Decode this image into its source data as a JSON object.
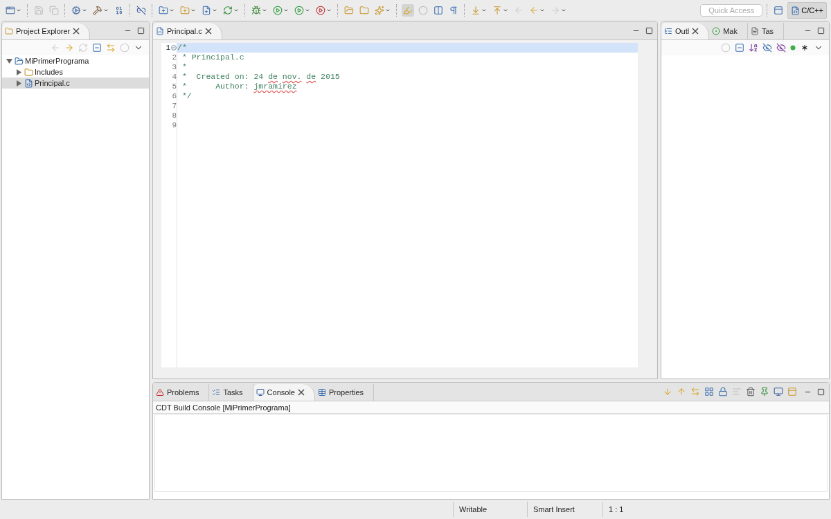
{
  "toolbar": {
    "quick_access": {
      "placeholder": "Quick Access"
    },
    "perspectives": [
      {
        "label": "C/C++",
        "selected": true
      }
    ]
  },
  "project_explorer": {
    "tabs": [
      {
        "label": "Project Explorer",
        "selected": true
      }
    ],
    "tree": [
      {
        "label": "MiPrimerPrograma",
        "expanded": true,
        "selected": false,
        "children": [
          {
            "label": "Includes",
            "expanded": false,
            "selected": false
          },
          {
            "label": "Principal.c",
            "expanded": false,
            "selected": true
          }
        ]
      }
    ]
  },
  "editor": {
    "tabs": [
      {
        "label": "Principal.c",
        "selected": true
      }
    ],
    "lines": [
      {
        "number": "1",
        "selected": true,
        "segments": [
          {
            "text": "/*",
            "misspelled": false
          }
        ]
      },
      {
        "number": "2",
        "selected": false,
        "segments": [
          {
            "text": " * Principal.c",
            "misspelled": false
          }
        ]
      },
      {
        "number": "3",
        "selected": false,
        "segments": [
          {
            "text": " *",
            "misspelled": false
          }
        ]
      },
      {
        "number": "4",
        "selected": false,
        "segments": [
          {
            "text": " *  Created on: 24 ",
            "misspelled": false
          },
          {
            "text": "de nov. de",
            "misspelled": true
          },
          {
            "text": " 2015",
            "misspelled": false
          }
        ]
      },
      {
        "number": "5",
        "selected": false,
        "segments": [
          {
            "text": " *      Author: ",
            "misspelled": false
          },
          {
            "text": "jmramirez",
            "misspelled": true
          }
        ]
      },
      {
        "number": "6",
        "selected": false,
        "segments": [
          {
            "text": " */",
            "misspelled": false
          }
        ]
      },
      {
        "number": "7",
        "selected": false
      },
      {
        "number": "8",
        "selected": false
      },
      {
        "number": "9",
        "selected": false
      }
    ]
  },
  "outline": {
    "tabs": [
      {
        "label": "Outl",
        "selected": true
      },
      {
        "label": "Mak",
        "selected": false
      },
      {
        "label": "Tas",
        "selected": false
      }
    ]
  },
  "console": {
    "tabs": [
      {
        "label": "Problems",
        "selected": false
      },
      {
        "label": "Tasks",
        "selected": false
      },
      {
        "label": "Console",
        "selected": true
      },
      {
        "label": "Properties",
        "selected": false
      }
    ],
    "title": "CDT Build Console [MiPrimerPrograma]"
  },
  "status_bar": [
    "Writable",
    "Smart Insert",
    "1 : 1"
  ]
}
